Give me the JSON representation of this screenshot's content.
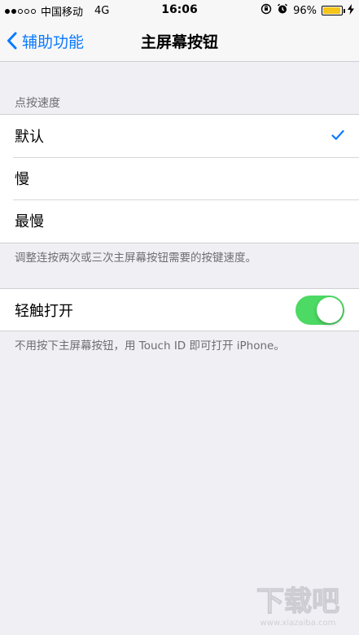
{
  "status_bar": {
    "signal_filled": 2,
    "signal_total": 5,
    "carrier": "中国移动",
    "network": "4G",
    "time": "16:06",
    "battery_percent_label": "96%",
    "battery_level": 0.96,
    "battery_color": "#f5c518"
  },
  "nav": {
    "back_label": "辅助功能",
    "title": "主屏幕按钮",
    "accent_color": "#0a7aff"
  },
  "click_speed": {
    "header": "点按速度",
    "options": [
      {
        "label": "默认",
        "selected": true
      },
      {
        "label": "慢",
        "selected": false
      },
      {
        "label": "最慢",
        "selected": false
      }
    ],
    "footer": "调整连按两次或三次主屏幕按钮需要的按键速度。"
  },
  "rest_to_open": {
    "label": "轻触打开",
    "enabled": true,
    "toggle_color": "#4cd964",
    "footer": "不用按下主屏幕按钮，用 Touch ID 即可打开 iPhone。"
  },
  "watermark": {
    "text": "下载吧",
    "url": "www.xiazaiba.com"
  }
}
